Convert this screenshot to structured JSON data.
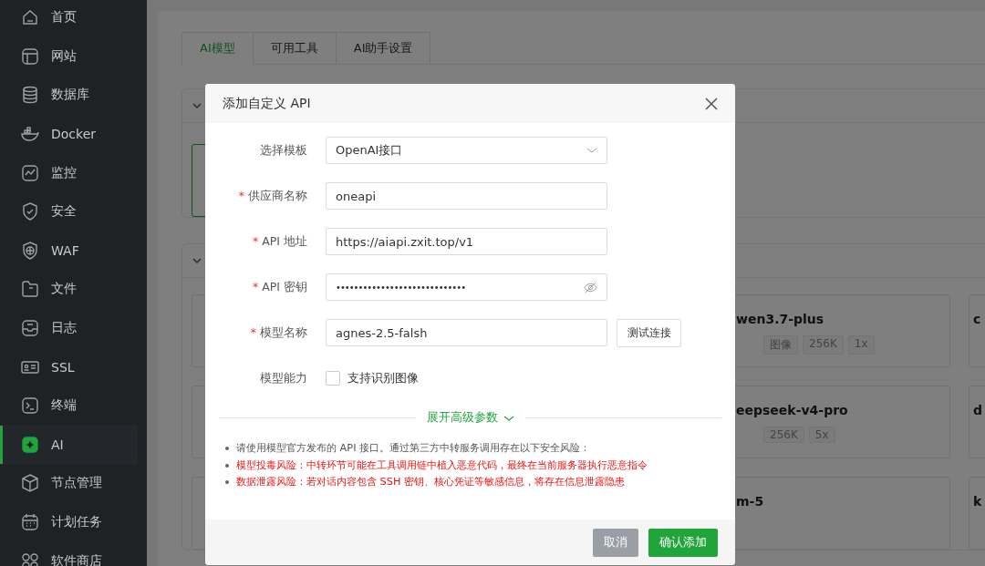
{
  "sidebar": {
    "items": [
      {
        "label": "首页",
        "selected": false
      },
      {
        "label": "网站",
        "selected": false
      },
      {
        "label": "数据库",
        "selected": false
      },
      {
        "label": "Docker",
        "selected": false
      },
      {
        "label": "监控",
        "selected": false
      },
      {
        "label": "安全",
        "selected": false
      },
      {
        "label": "WAF",
        "selected": false
      },
      {
        "label": "文件",
        "selected": false
      },
      {
        "label": "日志",
        "selected": false
      },
      {
        "label": "SSL",
        "selected": false
      },
      {
        "label": "终端",
        "selected": false
      },
      {
        "label": "AI",
        "selected": true
      },
      {
        "label": "节点管理",
        "selected": false
      },
      {
        "label": "计划任务",
        "selected": false
      },
      {
        "label": "软件商店",
        "selected": false
      }
    ]
  },
  "tabs": [
    {
      "label": "AI模型",
      "selected": true
    },
    {
      "label": "可用工具",
      "selected": false
    },
    {
      "label": "AI助手设置",
      "selected": false
    }
  ],
  "model_cards": [
    {
      "title": "wen3.7-plus",
      "tags": [
        "图像",
        "256K",
        "1x"
      ]
    },
    {
      "title": "eepseek-v4-pro",
      "tags": [
        "256K",
        "5x"
      ]
    },
    {
      "title": "m-5"
    }
  ],
  "edge_cards": [
    {
      "title": "c"
    },
    {
      "title": "d"
    },
    {
      "title": "k"
    }
  ],
  "dialog": {
    "title": "添加自定义 API",
    "fields": [
      {
        "kind": "select",
        "label": "选择模板",
        "value": "OpenAI接口"
      },
      {
        "kind": "text",
        "label": "供应商名称",
        "required_mark": "*",
        "value": "oneapi"
      },
      {
        "kind": "text",
        "label": "API 地址",
        "required_mark": "*",
        "value": "https://aiapi.zxit.top/v1"
      },
      {
        "kind": "password",
        "label": "API 密钥",
        "required_mark": "*",
        "value": "•••••••••••••••••••••••••••••"
      },
      {
        "kind": "text",
        "label": "模型名称",
        "required_mark": "*",
        "value": "agnes-2.5-falsh",
        "action": "测试连接"
      },
      {
        "kind": "checkbox",
        "label": "模型能力",
        "option": "支持识别图像",
        "checked": false
      }
    ],
    "advanced": "展开高级参数",
    "notes": [
      {
        "kind": "info",
        "text": "请使用模型官方发布的 API 接口。通过第三方中转服务调用存在以下安全风险："
      },
      {
        "kind": "warning",
        "text": "模型投毒风险：中转环节可能在工具调用链中植入恶意代码，最终在当前服务器执行恶意指令"
      },
      {
        "kind": "warning",
        "text": "数据泄露风险：若对话内容包含 SSH 密钥、核心凭证等敏感信息，将存在信息泄露隐患"
      }
    ],
    "buttons": [
      {
        "kind": "secondary",
        "label": "取消"
      },
      {
        "kind": "primary",
        "label": "确认添加"
      }
    ]
  }
}
